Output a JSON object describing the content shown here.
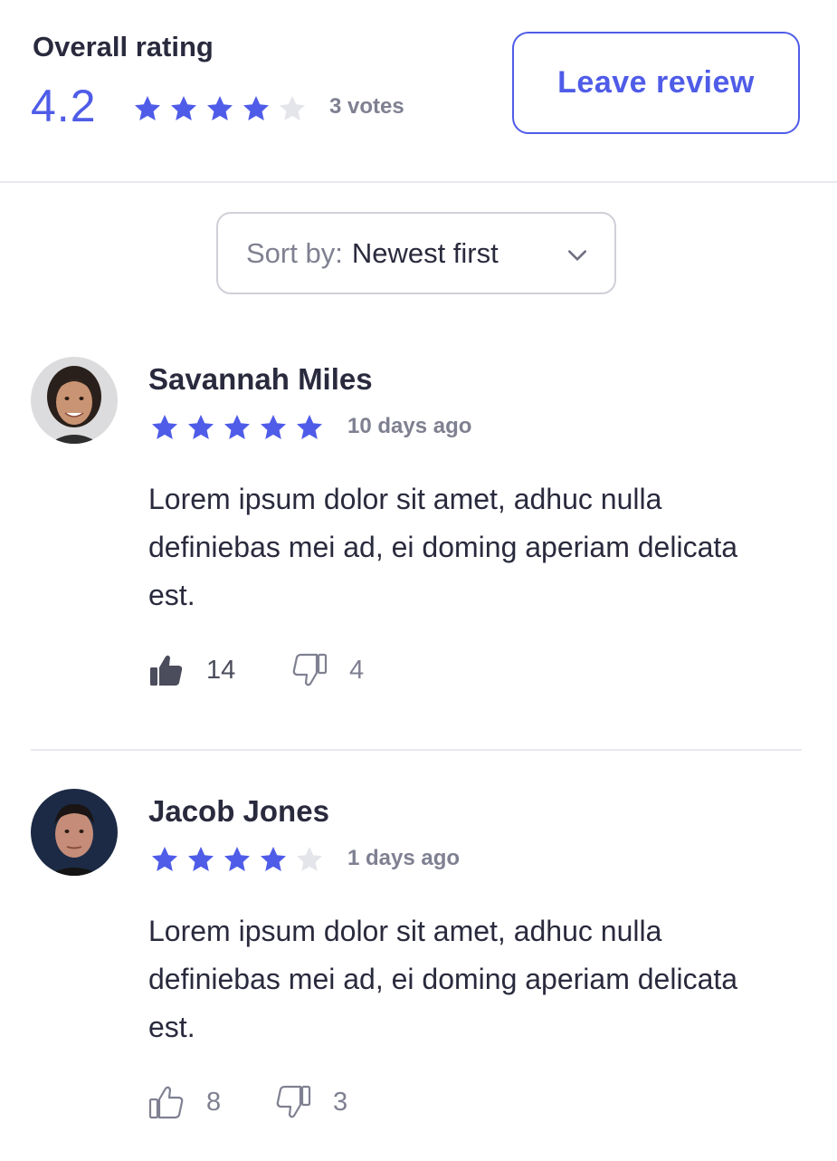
{
  "header": {
    "title": "Overall rating",
    "score": "4.2",
    "stars_filled": 4,
    "stars_total": 5,
    "votes": "3 votes",
    "leave_review_label": "Leave review"
  },
  "sort": {
    "prefix": "Sort by:",
    "value": "Newest first"
  },
  "reviews": [
    {
      "name": "Savannah Miles",
      "stars_filled": 5,
      "date": "10 days ago",
      "text": "Lorem ipsum dolor sit amet, adhuc nulla definiebas mei ad, ei doming aperiam delicata est.",
      "likes": "14",
      "dislikes": "4",
      "liked": true
    },
    {
      "name": "Jacob Jones",
      "stars_filled": 4,
      "date": "1 days ago",
      "text": "Lorem ipsum dolor sit amet, adhuc nulla definiebas mei ad, ei doming aperiam delicata est.",
      "likes": "8",
      "dislikes": "3",
      "liked": false
    }
  ],
  "colors": {
    "accent": "#4f5ce8",
    "star_empty": "#e4e5ea",
    "text": "#2a2a3e",
    "muted": "#7f8091"
  },
  "icons": {
    "star": "star-icon",
    "chevron": "chevron-down-icon",
    "like": "thumbs-up-icon",
    "dislike": "thumbs-down-icon"
  }
}
